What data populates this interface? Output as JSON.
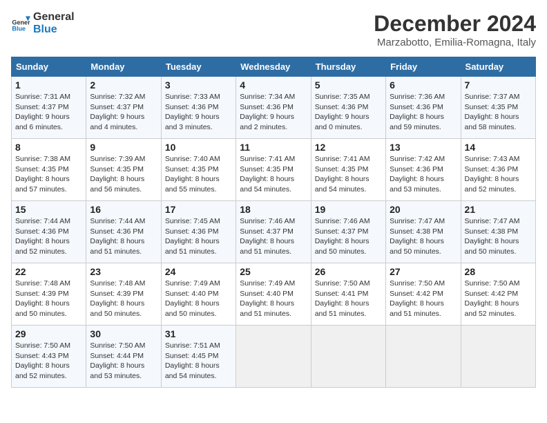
{
  "logo": {
    "line1": "General",
    "line2": "Blue"
  },
  "title": "December 2024",
  "subtitle": "Marzabotto, Emilia-Romagna, Italy",
  "weekdays": [
    "Sunday",
    "Monday",
    "Tuesday",
    "Wednesday",
    "Thursday",
    "Friday",
    "Saturday"
  ],
  "weeks": [
    [
      {
        "day": "1",
        "info": "Sunrise: 7:31 AM\nSunset: 4:37 PM\nDaylight: 9 hours and 6 minutes."
      },
      {
        "day": "2",
        "info": "Sunrise: 7:32 AM\nSunset: 4:37 PM\nDaylight: 9 hours and 4 minutes."
      },
      {
        "day": "3",
        "info": "Sunrise: 7:33 AM\nSunset: 4:36 PM\nDaylight: 9 hours and 3 minutes."
      },
      {
        "day": "4",
        "info": "Sunrise: 7:34 AM\nSunset: 4:36 PM\nDaylight: 9 hours and 2 minutes."
      },
      {
        "day": "5",
        "info": "Sunrise: 7:35 AM\nSunset: 4:36 PM\nDaylight: 9 hours and 0 minutes."
      },
      {
        "day": "6",
        "info": "Sunrise: 7:36 AM\nSunset: 4:36 PM\nDaylight: 8 hours and 59 minutes."
      },
      {
        "day": "7",
        "info": "Sunrise: 7:37 AM\nSunset: 4:35 PM\nDaylight: 8 hours and 58 minutes."
      }
    ],
    [
      {
        "day": "8",
        "info": "Sunrise: 7:38 AM\nSunset: 4:35 PM\nDaylight: 8 hours and 57 minutes."
      },
      {
        "day": "9",
        "info": "Sunrise: 7:39 AM\nSunset: 4:35 PM\nDaylight: 8 hours and 56 minutes."
      },
      {
        "day": "10",
        "info": "Sunrise: 7:40 AM\nSunset: 4:35 PM\nDaylight: 8 hours and 55 minutes."
      },
      {
        "day": "11",
        "info": "Sunrise: 7:41 AM\nSunset: 4:35 PM\nDaylight: 8 hours and 54 minutes."
      },
      {
        "day": "12",
        "info": "Sunrise: 7:41 AM\nSunset: 4:35 PM\nDaylight: 8 hours and 54 minutes."
      },
      {
        "day": "13",
        "info": "Sunrise: 7:42 AM\nSunset: 4:36 PM\nDaylight: 8 hours and 53 minutes."
      },
      {
        "day": "14",
        "info": "Sunrise: 7:43 AM\nSunset: 4:36 PM\nDaylight: 8 hours and 52 minutes."
      }
    ],
    [
      {
        "day": "15",
        "info": "Sunrise: 7:44 AM\nSunset: 4:36 PM\nDaylight: 8 hours and 52 minutes."
      },
      {
        "day": "16",
        "info": "Sunrise: 7:44 AM\nSunset: 4:36 PM\nDaylight: 8 hours and 51 minutes."
      },
      {
        "day": "17",
        "info": "Sunrise: 7:45 AM\nSunset: 4:36 PM\nDaylight: 8 hours and 51 minutes."
      },
      {
        "day": "18",
        "info": "Sunrise: 7:46 AM\nSunset: 4:37 PM\nDaylight: 8 hours and 51 minutes."
      },
      {
        "day": "19",
        "info": "Sunrise: 7:46 AM\nSunset: 4:37 PM\nDaylight: 8 hours and 50 minutes."
      },
      {
        "day": "20",
        "info": "Sunrise: 7:47 AM\nSunset: 4:38 PM\nDaylight: 8 hours and 50 minutes."
      },
      {
        "day": "21",
        "info": "Sunrise: 7:47 AM\nSunset: 4:38 PM\nDaylight: 8 hours and 50 minutes."
      }
    ],
    [
      {
        "day": "22",
        "info": "Sunrise: 7:48 AM\nSunset: 4:39 PM\nDaylight: 8 hours and 50 minutes."
      },
      {
        "day": "23",
        "info": "Sunrise: 7:48 AM\nSunset: 4:39 PM\nDaylight: 8 hours and 50 minutes."
      },
      {
        "day": "24",
        "info": "Sunrise: 7:49 AM\nSunset: 4:40 PM\nDaylight: 8 hours and 50 minutes."
      },
      {
        "day": "25",
        "info": "Sunrise: 7:49 AM\nSunset: 4:40 PM\nDaylight: 8 hours and 51 minutes."
      },
      {
        "day": "26",
        "info": "Sunrise: 7:50 AM\nSunset: 4:41 PM\nDaylight: 8 hours and 51 minutes."
      },
      {
        "day": "27",
        "info": "Sunrise: 7:50 AM\nSunset: 4:42 PM\nDaylight: 8 hours and 51 minutes."
      },
      {
        "day": "28",
        "info": "Sunrise: 7:50 AM\nSunset: 4:42 PM\nDaylight: 8 hours and 52 minutes."
      }
    ],
    [
      {
        "day": "29",
        "info": "Sunrise: 7:50 AM\nSunset: 4:43 PM\nDaylight: 8 hours and 52 minutes."
      },
      {
        "day": "30",
        "info": "Sunrise: 7:50 AM\nSunset: 4:44 PM\nDaylight: 8 hours and 53 minutes."
      },
      {
        "day": "31",
        "info": "Sunrise: 7:51 AM\nSunset: 4:45 PM\nDaylight: 8 hours and 54 minutes."
      },
      {
        "day": "",
        "info": ""
      },
      {
        "day": "",
        "info": ""
      },
      {
        "day": "",
        "info": ""
      },
      {
        "day": "",
        "info": ""
      }
    ]
  ]
}
